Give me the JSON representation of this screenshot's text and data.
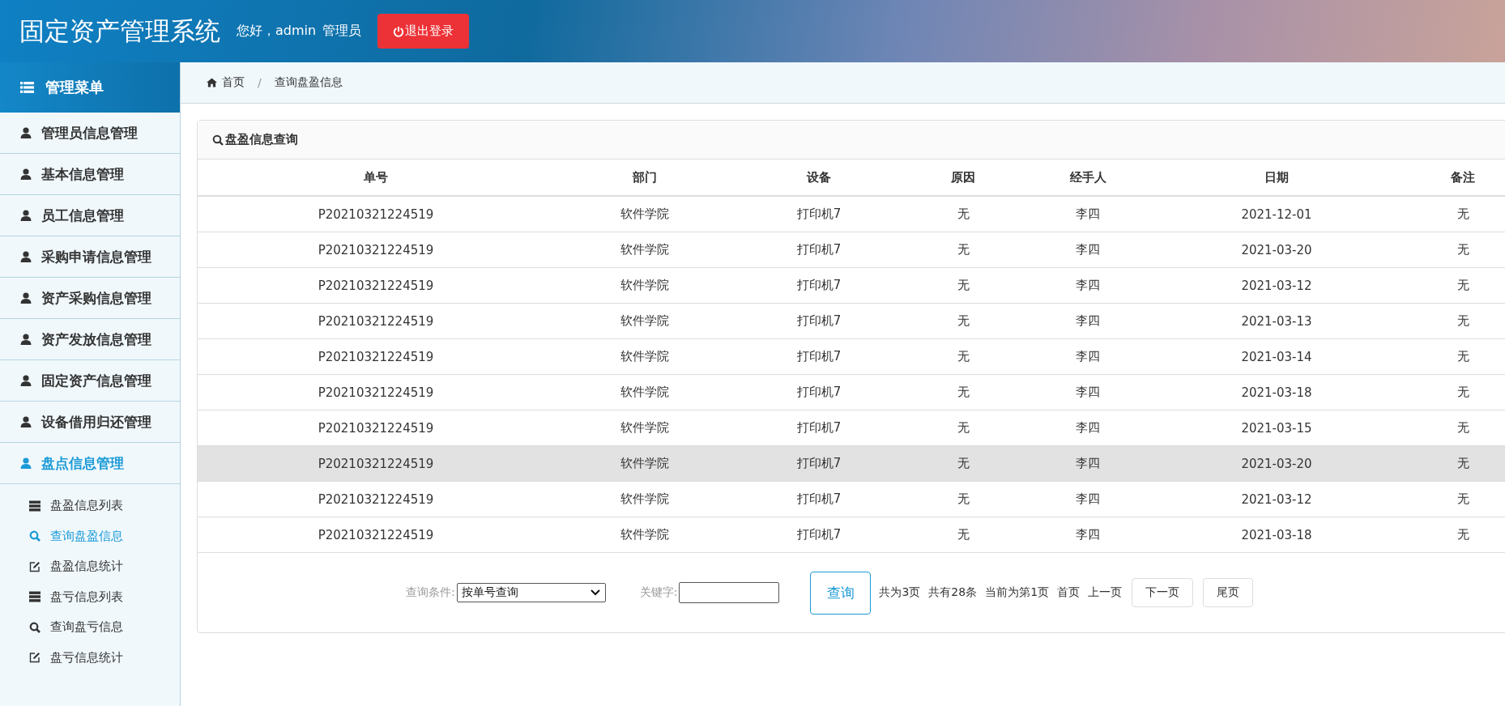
{
  "header": {
    "title": "固定资产管理系统",
    "greeting": "您好，admin",
    "role": "管理员",
    "logout_button": "退出登录"
  },
  "sidebar": {
    "title": "管理菜单",
    "items": [
      {
        "label": "管理员信息管理",
        "selected": false
      },
      {
        "label": "基本信息管理",
        "selected": false
      },
      {
        "label": "员工信息管理",
        "selected": false
      },
      {
        "label": "采购申请信息管理",
        "selected": false
      },
      {
        "label": "资产采购信息管理",
        "selected": false
      },
      {
        "label": "资产发放信息管理",
        "selected": false
      },
      {
        "label": "固定资产信息管理",
        "selected": false
      },
      {
        "label": "设备借用归还管理",
        "selected": false
      },
      {
        "label": "盘点信息管理",
        "selected": true,
        "expanded": true,
        "children": [
          {
            "label": "盘盈信息列表",
            "kind": "list",
            "selected": false
          },
          {
            "label": "查询盘盈信息",
            "kind": "search",
            "selected": true
          },
          {
            "label": "盘盈信息统计",
            "kind": "edit",
            "selected": false
          },
          {
            "label": "盘亏信息列表",
            "kind": "list",
            "selected": false
          },
          {
            "label": "查询盘亏信息",
            "kind": "search",
            "selected": false
          },
          {
            "label": "盘亏信息统计",
            "kind": "edit",
            "selected": false
          }
        ]
      }
    ]
  },
  "breadcrumb": {
    "separator": "/",
    "items": [
      "首页",
      "查询盘盈信息"
    ]
  },
  "panel": {
    "title": "盘盈信息查询"
  },
  "table": {
    "columns": [
      "单号",
      "部门",
      "设备",
      "原因",
      "经手人",
      "日期",
      "备注"
    ],
    "rows": [
      {
        "cells": [
          "P20210321224519",
          "软件学院",
          "打印机7",
          "无",
          "李四",
          "2021-12-01",
          "无"
        ],
        "highlighted": false
      },
      {
        "cells": [
          "P20210321224519",
          "软件学院",
          "打印机7",
          "无",
          "李四",
          "2021-03-20",
          "无"
        ],
        "highlighted": false
      },
      {
        "cells": [
          "P20210321224519",
          "软件学院",
          "打印机7",
          "无",
          "李四",
          "2021-03-12",
          "无"
        ],
        "highlighted": false
      },
      {
        "cells": [
          "P20210321224519",
          "软件学院",
          "打印机7",
          "无",
          "李四",
          "2021-03-13",
          "无"
        ],
        "highlighted": false
      },
      {
        "cells": [
          "P20210321224519",
          "软件学院",
          "打印机7",
          "无",
          "李四",
          "2021-03-14",
          "无"
        ],
        "highlighted": false
      },
      {
        "cells": [
          "P20210321224519",
          "软件学院",
          "打印机7",
          "无",
          "李四",
          "2021-03-18",
          "无"
        ],
        "highlighted": false
      },
      {
        "cells": [
          "P20210321224519",
          "软件学院",
          "打印机7",
          "无",
          "李四",
          "2021-03-15",
          "无"
        ],
        "highlighted": false
      },
      {
        "cells": [
          "P20210321224519",
          "软件学院",
          "打印机7",
          "无",
          "李四",
          "2021-03-20",
          "无"
        ],
        "highlighted": true
      },
      {
        "cells": [
          "P20210321224519",
          "软件学院",
          "打印机7",
          "无",
          "李四",
          "2021-03-12",
          "无"
        ],
        "highlighted": false
      },
      {
        "cells": [
          "P20210321224519",
          "软件学院",
          "打印机7",
          "无",
          "李四",
          "2021-03-18",
          "无"
        ],
        "highlighted": false
      }
    ]
  },
  "search": {
    "condition_label": "查询条件:",
    "condition_value": "按单号查询",
    "keyword_label": "关键字:",
    "search_button": "查询"
  },
  "pagination": {
    "total_pages": "共为3页",
    "total_records": "共有28条",
    "current_page": "当前为第1页",
    "first": "首页",
    "prev": "上一页",
    "next": "下一页",
    "last": "尾页"
  }
}
